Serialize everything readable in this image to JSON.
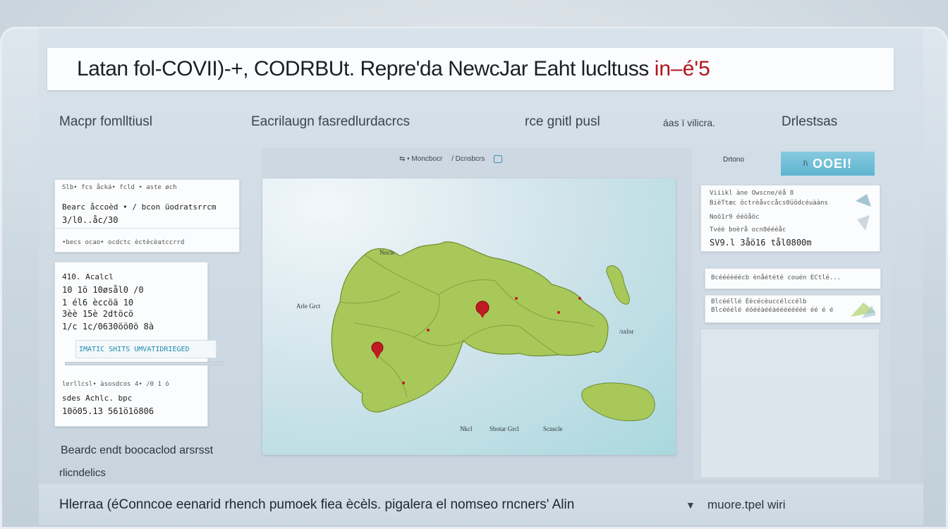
{
  "title": {
    "text": "Latan fol-COVII)-+, CODRBUt. Repre'dа NewcJar Eaht lucltuss",
    "accent": "in–é'5"
  },
  "nav": {
    "items": [
      "Macpr fomlltiusl",
      "Eacrilaugn fasredlurdacrcs",
      "rce gnitl pusl",
      "áas ï vilicra.",
      "Drlestsas"
    ]
  },
  "left_cards": {
    "card1": {
      "line1": "Slb• fcs åcká• fcld • aste øch",
      "line2": "Bearc åccoèd • / bcon üodratsrrcm",
      "line3": "3/l0..åc/30",
      "line4": "•becs ocao• ocdctc èctècèatccrrd"
    },
    "card2": {
      "line1": "410. Acalcl",
      "line2": "10 1ö 10øsål0 /0",
      "line3": "1 él6 èccöä 10",
      "line4": "3èè 15è 2dtöcö",
      "line5": "1/c 1c/0630öö0ö 8à",
      "tag": "IMATIC SHITS UMVATIDRIEGED",
      "line6": "lerllcsl• àsosdcos 4• /0 1 ó",
      "line7": "sdes Achlc. bpc",
      "line8": "10ö05.13 561ö1ö806"
    }
  },
  "map": {
    "toolbar": [
      "⇆ • Moncbocr",
      "/ Dcnsbcrs"
    ],
    "labels": [
      "Nocls",
      "Arle Grct",
      "/sxlor",
      "Nkcl",
      "Sbotar Grcl",
      "Scnscle"
    ]
  },
  "right": {
    "header": "Drtono",
    "button_prefix": "l\\",
    "button": "OOEI!",
    "card1": {
      "line1": "Viiikl àne Owscne/éå 8",
      "line2": "BièTtæc öctrèåvccåcs0üödcéuààns",
      "line3": "Noö1r9 ééöåöc",
      "line4": "Tvéè boèrå ocn8éééåc",
      "line5": "SV9.l 3åö16 tål0800m"
    },
    "card2": {
      "line1": "Bcéééèéécb ènåétété couén ECtlé..."
    },
    "card3": {
      "line1": "Blcééllé Éècécèuccélccélb",
      "line2": "Blcééélé éöééàééàéééééééé éé é é"
    }
  },
  "bottom_left": {
    "line1": "Beardc endt boocaclod arsrsst",
    "line2": "rlicndelics"
  },
  "footer": {
    "text": "Hlerraa (éConncoe eenarid rhench pumoek fiea ècèls. pigalera el nomseo rncners' Alin",
    "right": "muore.tpel wiri"
  },
  "colors": {
    "accent_red": "#b3141c",
    "button_blue": "#5fb4d0",
    "land_green": "#a8c85a"
  }
}
